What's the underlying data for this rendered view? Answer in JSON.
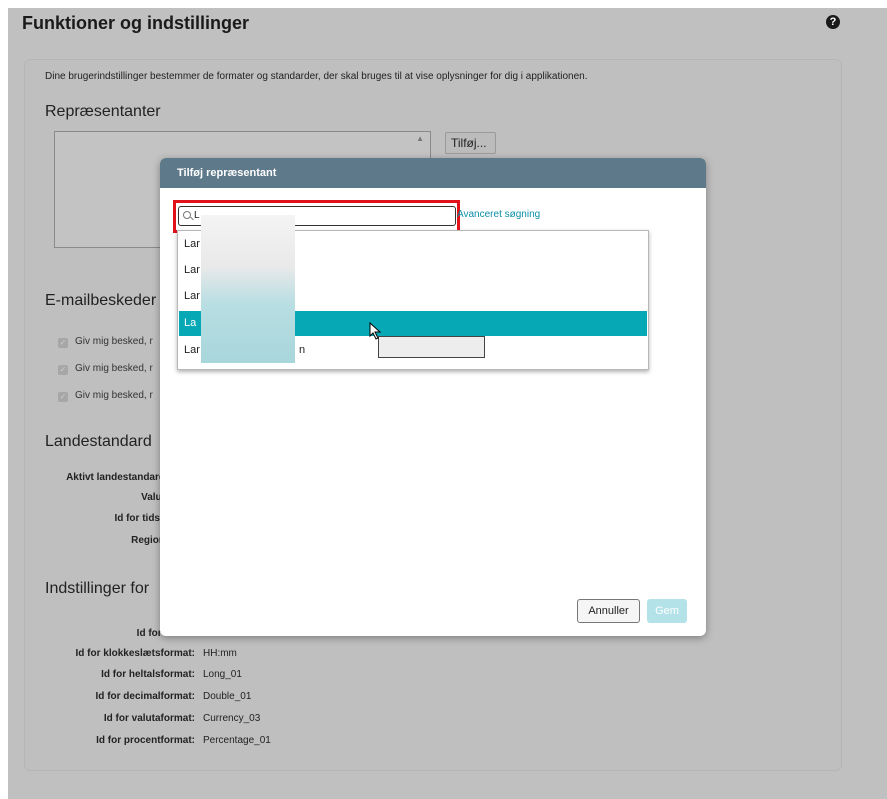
{
  "page": {
    "title": "Funktioner og indstillinger",
    "help_icon": "question-circle-icon",
    "intro": "Dine brugerindstillinger bestemmer de formater og standarder, der skal bruges til at vise oplysninger for dig i applikationen."
  },
  "representatives": {
    "heading": "Repræsentanter",
    "add_button": "Tilføj..."
  },
  "email": {
    "heading": "E-mailbeskeder",
    "checkboxes": [
      "Giv mig besked, r",
      "Giv mig besked, r",
      "Giv mig besked, r"
    ]
  },
  "locale": {
    "heading": "Landestandard",
    "rows": [
      {
        "label": "Aktivt landestandard"
      },
      {
        "label": "Valut"
      },
      {
        "label": "Id for tidsz"
      },
      {
        "label": "Region"
      }
    ]
  },
  "formats": {
    "heading": "Indstillinger for",
    "rows": [
      {
        "label": "Id for datofo",
        "value": ""
      },
      {
        "label": "Id for klokkeslætsformat:",
        "value": "HH:mm"
      },
      {
        "label": "Id for heltalsformat:",
        "value": "Long_01"
      },
      {
        "label": "Id for decimalformat:",
        "value": "Double_01"
      },
      {
        "label": "Id for valutaformat:",
        "value": "Currency_03"
      },
      {
        "label": "Id for procentformat:",
        "value": "Percentage_01"
      }
    ]
  },
  "dialog": {
    "title": "Tilføj repræsentant",
    "search_value": "L",
    "advanced_search": "Avanceret søgning",
    "results": [
      "Lar",
      "Lar",
      "Lar",
      "La",
      "Lar"
    ],
    "selected_index": 3,
    "results_tail": "n",
    "cancel_label": "Annuller",
    "save_label": "Gem"
  },
  "colors": {
    "header": "#5e7a8a",
    "accent": "#06a8b5",
    "link": "#0b8fa6",
    "highlight": "#e2121b"
  }
}
